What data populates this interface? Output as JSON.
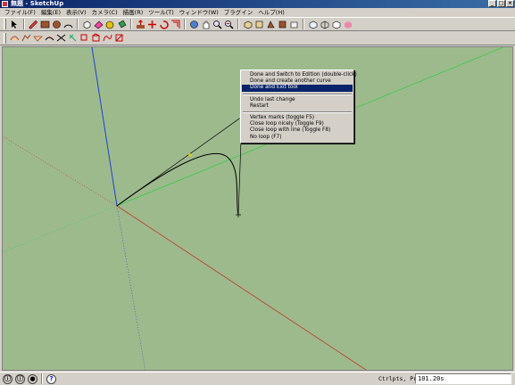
{
  "window": {
    "title": "無題 - SketchUp"
  },
  "menubar": {
    "items": [
      "ファイル(F)",
      "編集(E)",
      "表示(V)",
      "カメラ(C)",
      "描画(R)",
      "ツール(T)",
      "ウィンドウ(W)",
      "プラグイン",
      "ヘルプ(H)"
    ]
  },
  "context_menu": {
    "items": [
      "Done and Switch to Edition (double-click)",
      "Done and create another curve",
      "Done and Exit tool",
      "Undo last change",
      "Restart",
      "Vertex marks (toggle F5)",
      "Close loop nicely (Toggle F9)",
      "Close loop with line (Toggle F8)",
      "No loop (F7)"
    ],
    "selected_index": 2
  },
  "statusbar": {
    "measure_label": "Ctrlpts, Prec",
    "measure_value": "101.20s"
  },
  "colors": {
    "viewport_bg": "#9dba8d",
    "axis_red": "#c0392b",
    "axis_green": "#2ecc40",
    "axis_blue": "#1f3fd6",
    "menu_highlight": "#0a246a"
  }
}
